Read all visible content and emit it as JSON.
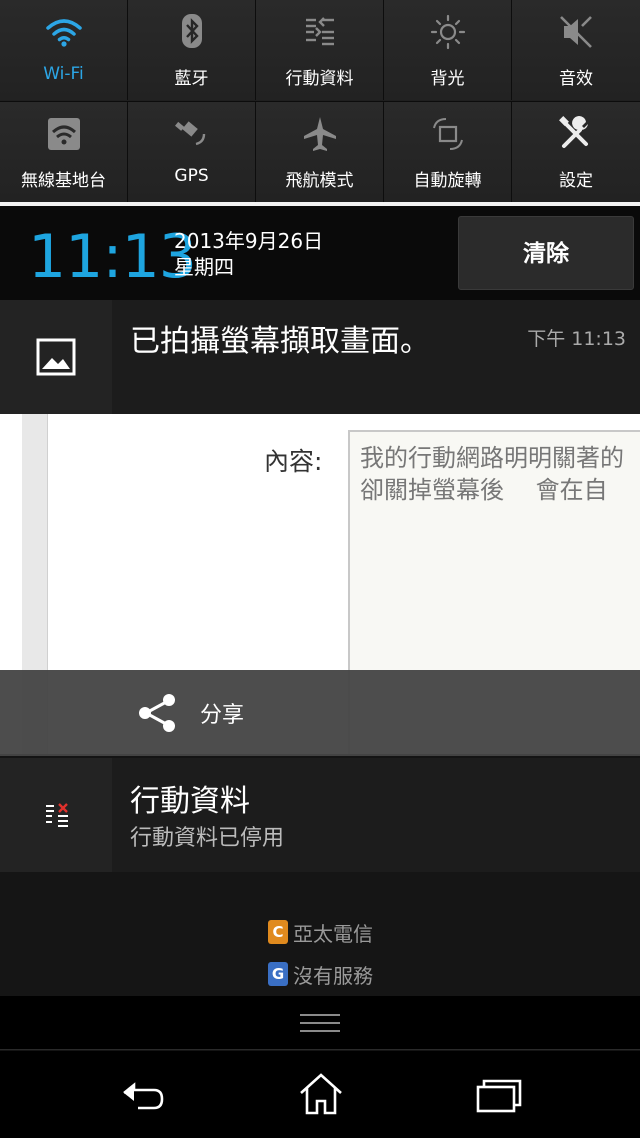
{
  "quick_settings": {
    "tiles": [
      {
        "label": "Wi-Fi",
        "icon": "wifi-icon",
        "active": true
      },
      {
        "label": "藍牙",
        "icon": "bluetooth-icon",
        "active": false
      },
      {
        "label": "行動資料",
        "icon": "mobile-data-icon",
        "active": false
      },
      {
        "label": "背光",
        "icon": "brightness-icon",
        "active": false
      },
      {
        "label": "音效",
        "icon": "sound-off-icon",
        "active": false
      },
      {
        "label": "無線基地台",
        "icon": "hotspot-icon",
        "active": false
      },
      {
        "label": "GPS",
        "icon": "gps-icon",
        "active": false
      },
      {
        "label": "飛航模式",
        "icon": "airplane-icon",
        "active": false
      },
      {
        "label": "自動旋轉",
        "icon": "rotate-icon",
        "active": false
      },
      {
        "label": "設定",
        "icon": "settings-icon",
        "active": false
      }
    ]
  },
  "header": {
    "time": "11:13",
    "date": "2013年9月26日",
    "weekday": "星期四",
    "clear_label": "清除"
  },
  "notifications": {
    "screenshot": {
      "title": "已拍攝螢幕擷取畫面。",
      "time": "下午 11:13",
      "icon": "image-icon",
      "share_label": "分享",
      "preview": {
        "label": "內容:",
        "line1": "我的行動網路明明關著的",
        "line2": "卻關掉螢幕後　  會在自"
      }
    },
    "mobile_data": {
      "title": "行動資料",
      "subtitle": "行動資料已停用",
      "icon": "mobile-data-disabled-icon"
    }
  },
  "carriers": [
    {
      "badge": "C",
      "name": "亞太電信",
      "color": "#e08a1e"
    },
    {
      "badge": "G",
      "name": "沒有服務",
      "color": "#3a6fc4"
    }
  ],
  "nav": {
    "back_icon": "back-icon",
    "home_icon": "home-icon",
    "recents_icon": "recents-icon"
  },
  "colors": {
    "accent": "#1ea5e0",
    "panel": "#1c1c1c"
  }
}
